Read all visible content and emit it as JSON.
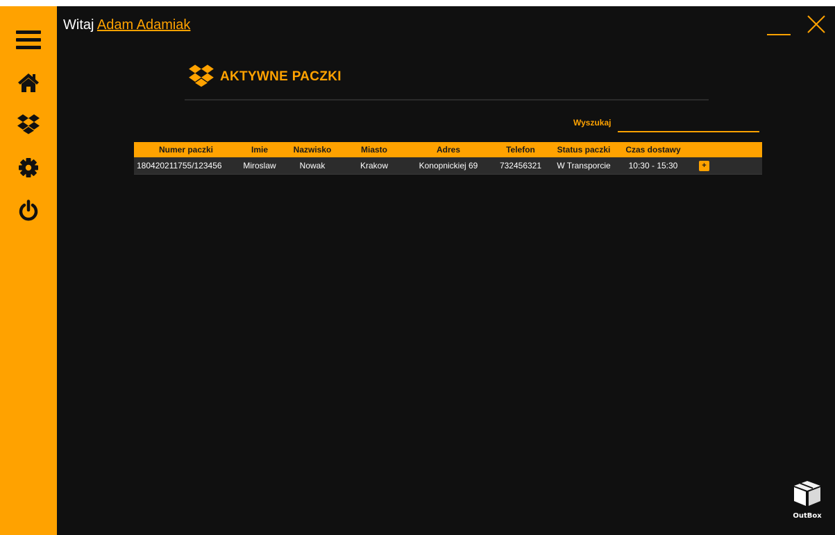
{
  "greeting": {
    "prefix": "Witaj",
    "user_name": "Adam Adamiak"
  },
  "sidebar": {
    "items": [
      {
        "icon": "hamburger-menu-icon"
      },
      {
        "icon": "home-icon"
      },
      {
        "icon": "dropbox-packages-icon"
      },
      {
        "icon": "gear-icon"
      },
      {
        "icon": "power-icon"
      }
    ]
  },
  "window_controls": {
    "minimize": "minimize-icon",
    "close": "close-icon"
  },
  "page": {
    "title": "AKTYWNE PACZKI",
    "title_icon": "dropbox-packages-icon"
  },
  "search": {
    "label": "Wyszukaj",
    "value": ""
  },
  "table": {
    "columns": [
      "Numer paczki",
      "Imie",
      "Nazwisko",
      "Miasto",
      "Adres",
      "Telefon",
      "Status paczki",
      "Czas dostawy",
      ""
    ],
    "rows": [
      {
        "numer": "180420211755/123456",
        "imie": "Miroslaw",
        "nazwisko": "Nowak",
        "miasto": "Krakow",
        "adres": "Konopnickiej 69",
        "telefon": "732456321",
        "status": "W Transporcie",
        "czas": "10:30 - 15:30",
        "action": "+"
      }
    ]
  },
  "logo": {
    "text": "OutBox"
  },
  "colors": {
    "accent": "#ffa200",
    "background": "#101010",
    "row": "#2c2c2c"
  }
}
